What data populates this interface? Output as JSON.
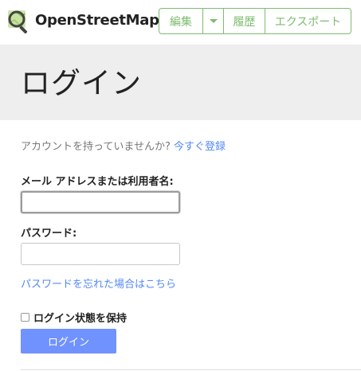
{
  "header": {
    "brand": "OpenStreetMap",
    "nav": {
      "edit_label": "編集",
      "history_label": "履歴",
      "export_label": "エクスポート"
    }
  },
  "page": {
    "title": "ログイン"
  },
  "form": {
    "no_account_text": "アカウントを持っていませんか?",
    "register_link": "今すぐ登録",
    "username_label": "メール アドレスまたは利用者名:",
    "username_value": "",
    "password_label": "パスワード:",
    "password_value": "",
    "forgot_link": "パスワードを忘れた場合はこちら",
    "remember_label": "ログイン状態を保持",
    "remember_checked": false,
    "submit_label": "ログイン"
  },
  "colors": {
    "brand_green": "#7ebc6f",
    "link_blue": "#5488f5",
    "submit_blue": "#7092ff",
    "title_band": "#eeeeee"
  },
  "icons": {
    "logo": "osm-magnifier-logo-icon",
    "caret": "caret-down-icon",
    "checkbox": "checkbox-icon"
  }
}
